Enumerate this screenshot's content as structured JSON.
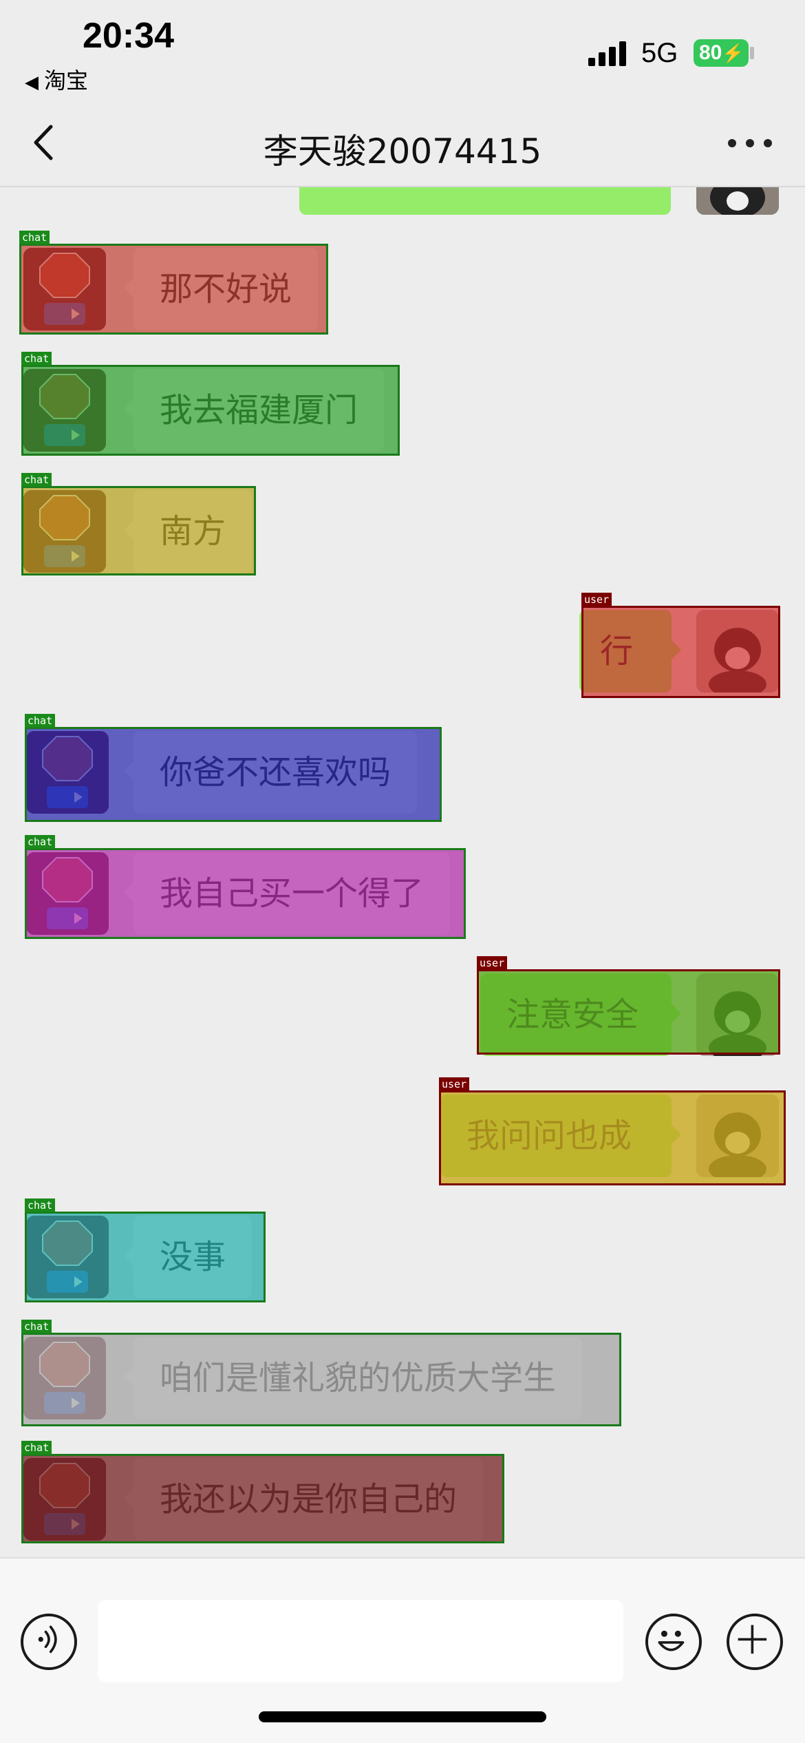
{
  "status_bar": {
    "time": "20:34",
    "back_app": "淘宝",
    "network": "5G",
    "battery": "80"
  },
  "nav": {
    "title": "李天骏20074415"
  },
  "messages": [
    {
      "side": "right",
      "text": ""
    },
    {
      "side": "left",
      "text": "那不好说",
      "tag": "chat"
    },
    {
      "side": "left",
      "text": "我去福建厦门",
      "tag": "chat"
    },
    {
      "side": "left",
      "text": "南方",
      "tag": "chat"
    },
    {
      "side": "right",
      "text": "行",
      "tag": "user"
    },
    {
      "side": "left",
      "text": "你爸不还喜欢吗",
      "tag": "chat"
    },
    {
      "side": "left",
      "text": "我自己买一个得了",
      "tag": "chat"
    },
    {
      "side": "right",
      "text": "注意安全",
      "tag": "user"
    },
    {
      "side": "right",
      "text": "我问问也成",
      "tag": "user"
    },
    {
      "side": "left",
      "text": "没事",
      "tag": "chat"
    },
    {
      "side": "left",
      "text": "咱们是懂礼貌的优质大学生",
      "tag": "chat"
    },
    {
      "side": "left",
      "text": "我还以为是你自己的",
      "tag": "chat"
    }
  ],
  "overlay_colors": {
    "m1": "#c0392b",
    "m2": "#2e9e2e",
    "m3": "#b5a21e",
    "m4": "#d42a2a",
    "m5": "#2a2ab0",
    "m6": "#b02aa8",
    "m7": "#5aa81e",
    "m8": "#c9a81e",
    "m9": "#1eaaa8",
    "m10": "#a8a8a8",
    "m11": "#7a2a2a"
  },
  "input": {
    "placeholder": ""
  },
  "icons": {
    "back": "chevron-left-icon",
    "more": "more-dots-icon",
    "voice": "voice-icon",
    "emoji": "emoji-icon",
    "plus": "plus-icon"
  }
}
